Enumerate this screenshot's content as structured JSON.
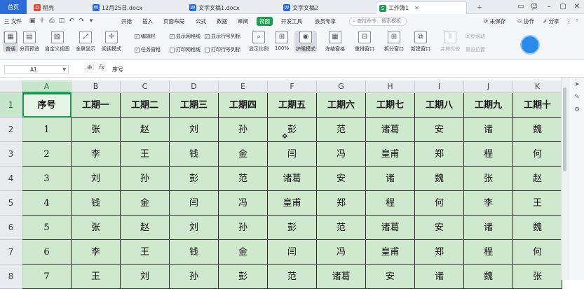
{
  "tabbar": {
    "home": "首页",
    "tabs": [
      {
        "label": "稻壳",
        "icon": "daoke-icon",
        "color": "#e24a3b"
      },
      {
        "label": "12月25日.docx",
        "icon": "word-doc-icon",
        "color": "#2b6cd8"
      },
      {
        "label": "文字文稿1.docx",
        "icon": "word-doc-icon",
        "color": "#2b6cd8"
      },
      {
        "label": "文字文稿2",
        "icon": "word-doc-icon",
        "color": "#2b6cd8"
      },
      {
        "label": "工作簿1",
        "icon": "sheet-icon",
        "color": "#1f9d55",
        "active": true
      }
    ],
    "unsynced": "未保存",
    "collab": "协作",
    "share": "分享"
  },
  "menubar": {
    "file": "三 文件",
    "items": [
      "开始",
      "插入",
      "页面布局",
      "公式",
      "数据",
      "审阅",
      "视图",
      "开发工具",
      "会员专享"
    ],
    "active": "视图",
    "search_placeholder": "查找命令、搜索模板"
  },
  "ribbon": {
    "normal": "普通",
    "page_break": "分页预览",
    "custom_view": "自定义视图",
    "fullscreen": "全屏显示",
    "reading_mode": "阅读模式",
    "checks": [
      {
        "label": "编辑栏",
        "on": true
      },
      {
        "label": "显示网格线",
        "on": true
      },
      {
        "label": "显示行号列标",
        "on": true
      },
      {
        "label": "任务窗格",
        "on": true
      },
      {
        "label": "打印网格线",
        "on": false
      },
      {
        "label": "打印行号列标",
        "on": false
      }
    ],
    "zoom_ratio": "显示比例",
    "zoom_100": "100%",
    "eye_protect": "护眼模式",
    "freeze": "冻结窗格",
    "rearrange": "重排窗口",
    "split": "拆分窗口",
    "new_window": "新建窗口",
    "sync_scroll": "同步滚动",
    "side_by_side": "并排比较",
    "reset_position": "重设位置"
  },
  "formula": {
    "cell_ref": "A1",
    "content": "序号"
  },
  "grid": {
    "columns": [
      "A",
      "B",
      "C",
      "D",
      "E",
      "F",
      "G",
      "H",
      "I",
      "J",
      "K"
    ],
    "row_numbers": [
      "1",
      "2",
      "3",
      "4",
      "5",
      "6",
      "7",
      "8"
    ],
    "rows": [
      [
        "序号",
        "工期一",
        "工期二",
        "工期三",
        "工期四",
        "工期五",
        "工期六",
        "工期七",
        "工期八",
        "工期九",
        "工期十"
      ],
      [
        "1",
        "张",
        "赵",
        "刘",
        "孙",
        "彭",
        "范",
        "诸葛",
        "安",
        "诸",
        "魏"
      ],
      [
        "2",
        "李",
        "王",
        "钱",
        "金",
        "闫",
        "冯",
        "皇甫",
        "郑",
        "程",
        "何"
      ],
      [
        "3",
        "刘",
        "孙",
        "彭",
        "范",
        "诸葛",
        "安",
        "诸",
        "魏",
        "张",
        "赵"
      ],
      [
        "4",
        "钱",
        "金",
        "闫",
        "冯",
        "皇甫",
        "郑",
        "程",
        "何",
        "李",
        "王"
      ],
      [
        "5",
        "张",
        "赵",
        "刘",
        "孙",
        "彭",
        "范",
        "诸葛",
        "安",
        "诸",
        "魏"
      ],
      [
        "6",
        "李",
        "王",
        "钱",
        "金",
        "闫",
        "冯",
        "皇甫",
        "郑",
        "程",
        "何"
      ],
      [
        "7",
        "王",
        "刘",
        "孙",
        "彭",
        "范",
        "诸葛",
        "安",
        "诸",
        "魏",
        "张"
      ]
    ]
  }
}
